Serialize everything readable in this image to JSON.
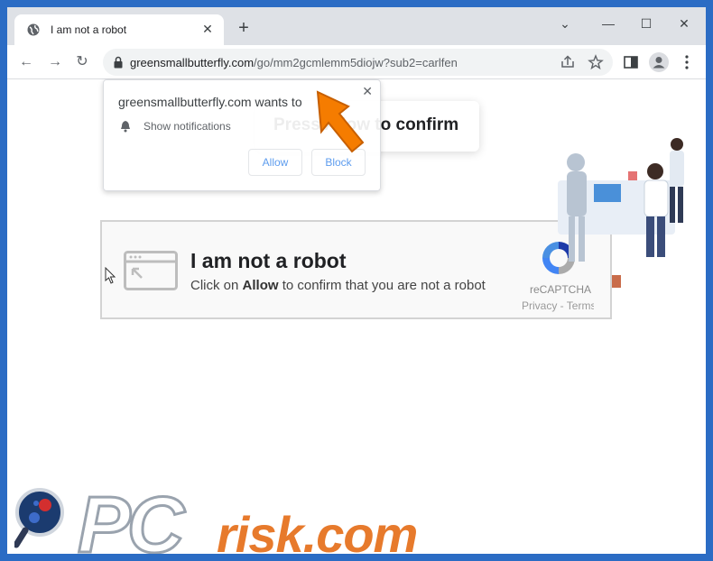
{
  "tab": {
    "title": "I am not a robot",
    "close": "✕",
    "new_tab": "+"
  },
  "window_controls": {
    "dropdown": "⌄",
    "minimize": "—",
    "maximize": "☐",
    "close": "✕"
  },
  "nav": {
    "back": "←",
    "forward": "→",
    "reload": "↻"
  },
  "address": {
    "host": "greensmallbutterfly.com",
    "path": "/go/mm2gcmlemm5diojw?sub2=carlfen"
  },
  "notification": {
    "site_text": "greensmallbutterfly.com wants to",
    "permission": "Show notifications",
    "allow": "Allow",
    "block": "Block",
    "close": "✕"
  },
  "press_box": {
    "text": "Press Allow to confirm"
  },
  "captcha": {
    "headline": "I am not a robot",
    "sub_pre": "Click on ",
    "sub_bold": "Allow",
    "sub_post": " to confirm that you are not a robot",
    "brand": "reCAPTCHA",
    "links": "Privacy - Terms"
  },
  "watermark": {
    "text": "PCrisk.com"
  },
  "colors": {
    "accent": "#1a73e8",
    "arrow": "#f57c00",
    "frame": "#2b6cc4"
  }
}
